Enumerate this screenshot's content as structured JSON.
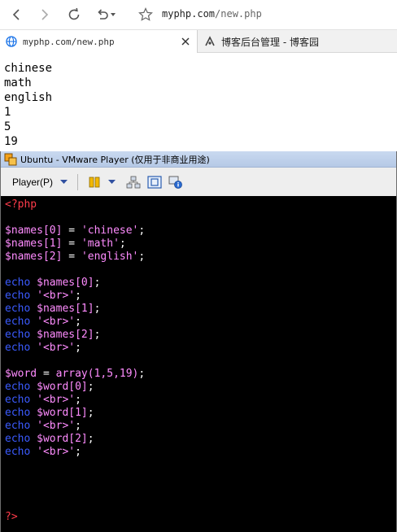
{
  "browser": {
    "address": {
      "host": "myphp.com",
      "path": "/new.php"
    },
    "tabs": [
      {
        "label": "myphp.com/new.php",
        "active": true
      },
      {
        "label": "博客后台管理 - 博客园",
        "active": false
      }
    ]
  },
  "page_output": [
    "chinese",
    "math",
    "english",
    "1",
    "5",
    "19"
  ],
  "vmware": {
    "title": "Ubuntu - VMware Player (仅用于非商业用途)",
    "player_menu": "Player(P)"
  },
  "terminal": {
    "lines": [
      [
        {
          "t": "<?php",
          "c": "tag"
        }
      ],
      [],
      [
        {
          "t": "$names",
          "c": "var"
        },
        {
          "t": "[0]",
          "c": "idx"
        },
        {
          "t": " = ",
          "c": "op"
        },
        {
          "t": "'chinese'",
          "c": "str"
        },
        {
          "t": ";",
          "c": "punct"
        }
      ],
      [
        {
          "t": "$names",
          "c": "var"
        },
        {
          "t": "[1]",
          "c": "idx"
        },
        {
          "t": " = ",
          "c": "op"
        },
        {
          "t": "'math'",
          "c": "str"
        },
        {
          "t": ";",
          "c": "punct"
        }
      ],
      [
        {
          "t": "$names",
          "c": "var"
        },
        {
          "t": "[2]",
          "c": "idx"
        },
        {
          "t": " = ",
          "c": "op"
        },
        {
          "t": "'english'",
          "c": "str"
        },
        {
          "t": ";",
          "c": "punct"
        }
      ],
      [],
      [
        {
          "t": "echo",
          "c": "kw"
        },
        {
          "t": " ",
          "c": "op"
        },
        {
          "t": "$names",
          "c": "var"
        },
        {
          "t": "[0]",
          "c": "idx"
        },
        {
          "t": ";",
          "c": "punct"
        }
      ],
      [
        {
          "t": "echo",
          "c": "kw"
        },
        {
          "t": " ",
          "c": "op"
        },
        {
          "t": "'<br>'",
          "c": "str"
        },
        {
          "t": ";",
          "c": "punct"
        }
      ],
      [
        {
          "t": "echo",
          "c": "kw"
        },
        {
          "t": " ",
          "c": "op"
        },
        {
          "t": "$names",
          "c": "var"
        },
        {
          "t": "[1]",
          "c": "idx"
        },
        {
          "t": ";",
          "c": "punct"
        }
      ],
      [
        {
          "t": "echo",
          "c": "kw"
        },
        {
          "t": " ",
          "c": "op"
        },
        {
          "t": "'<br>'",
          "c": "str"
        },
        {
          "t": ";",
          "c": "punct"
        }
      ],
      [
        {
          "t": "echo",
          "c": "kw"
        },
        {
          "t": " ",
          "c": "op"
        },
        {
          "t": "$names",
          "c": "var"
        },
        {
          "t": "[2]",
          "c": "idx"
        },
        {
          "t": ";",
          "c": "punct"
        }
      ],
      [
        {
          "t": "echo",
          "c": "kw"
        },
        {
          "t": " ",
          "c": "op"
        },
        {
          "t": "'<br>'",
          "c": "str"
        },
        {
          "t": ";",
          "c": "punct"
        }
      ],
      [],
      [
        {
          "t": "$word",
          "c": "var"
        },
        {
          "t": " = ",
          "c": "op"
        },
        {
          "t": "array",
          "c": "fn"
        },
        {
          "t": "(1,5,19)",
          "c": "idx"
        },
        {
          "t": ";",
          "c": "punct"
        }
      ],
      [
        {
          "t": "echo",
          "c": "kw"
        },
        {
          "t": " ",
          "c": "op"
        },
        {
          "t": "$word",
          "c": "var"
        },
        {
          "t": "[0]",
          "c": "idx"
        },
        {
          "t": ";",
          "c": "punct"
        }
      ],
      [
        {
          "t": "echo",
          "c": "kw"
        },
        {
          "t": " ",
          "c": "op"
        },
        {
          "t": "'<br>'",
          "c": "str"
        },
        {
          "t": ";",
          "c": "punct"
        }
      ],
      [
        {
          "t": "echo",
          "c": "kw"
        },
        {
          "t": " ",
          "c": "op"
        },
        {
          "t": "$word",
          "c": "var"
        },
        {
          "t": "[1]",
          "c": "idx"
        },
        {
          "t": ";",
          "c": "punct"
        }
      ],
      [
        {
          "t": "echo",
          "c": "kw"
        },
        {
          "t": " ",
          "c": "op"
        },
        {
          "t": "'<br>'",
          "c": "str"
        },
        {
          "t": ";",
          "c": "punct"
        }
      ],
      [
        {
          "t": "echo",
          "c": "kw"
        },
        {
          "t": " ",
          "c": "op"
        },
        {
          "t": "$word",
          "c": "var"
        },
        {
          "t": "[2]",
          "c": "idx"
        },
        {
          "t": ";",
          "c": "punct"
        }
      ],
      [
        {
          "t": "echo",
          "c": "kw"
        },
        {
          "t": " ",
          "c": "op"
        },
        {
          "t": "'<br>'",
          "c": "str"
        },
        {
          "t": ";",
          "c": "punct"
        }
      ],
      [],
      [],
      [],
      [],
      [
        {
          "t": "?>",
          "c": "tag"
        }
      ]
    ]
  },
  "icons": {
    "back": "arrow-left-icon",
    "forward": "arrow-right-icon",
    "reload": "reload-icon",
    "undo": "undo-icon",
    "favorite": "star-icon",
    "tab_active": "globe-icon",
    "tab_inactive": "cnblogs-icon",
    "tab_close": "close-icon",
    "vmware_logo": "vmware-logo-icon",
    "pause": "pause-icon",
    "send_ctrl_alt_del": "network-icon",
    "fullscreen": "fullscreen-icon",
    "unity": "unity-icon"
  },
  "colors": {
    "php_tag": "#ff3b4a",
    "variable": "#ff8cff",
    "keyword": "#3b5bff",
    "terminal_bg": "#000000",
    "tab_strip": "#f1f1f1",
    "vm_title": "#c9d9f0"
  }
}
